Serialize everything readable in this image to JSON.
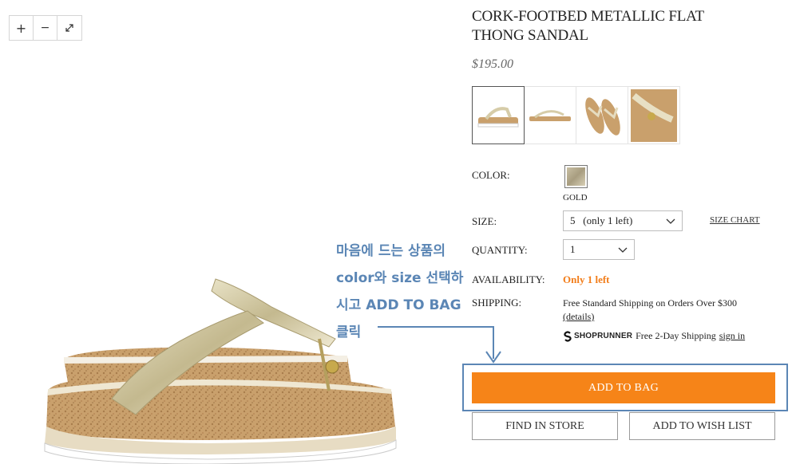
{
  "zoom_controls": {
    "zoom_in": "+",
    "zoom_out": "−"
  },
  "product": {
    "title": "CORK-FOOTBED METALLIC FLAT THONG SANDAL",
    "price": "$195.00"
  },
  "options": {
    "color_label": "COLOR:",
    "color_name": "GOLD",
    "size_label": "SIZE:",
    "size_value": "5   (only 1 left)",
    "size_chart": "SIZE CHART",
    "quantity_label": "QUANTITY:",
    "quantity_value": "1",
    "availability_label": "AVAILABILITY:",
    "availability_value": "Only 1 left",
    "shipping_label": "SHIPPING:",
    "shipping_text": "Free Standard Shipping on Orders Over $300",
    "shipping_details": "(details)",
    "shoprunner_brand": "SHOPRUNNER",
    "shoprunner_text": "Free 2-Day Shipping",
    "shoprunner_signin": "sign in"
  },
  "buttons": {
    "add_to_bag": "ADD TO BAG",
    "find_in_store": "FIND IN STORE",
    "add_to_wish_list": "ADD TO WISH LIST"
  },
  "annotation": {
    "line1": "마음에 드는 상품의",
    "line2": "color와 size 선택하",
    "line3": "시고 ADD TO BAG",
    "line4": "클릭"
  },
  "colors": {
    "accent_orange": "#f68418",
    "availability_orange": "#f27d1a",
    "annotation_blue": "#5b86b5"
  },
  "icons": {
    "zoom_in": "plus-icon",
    "zoom_out": "minus-icon",
    "fullscreen": "expand-icon",
    "dropdown": "chevron-down-icon",
    "shoprunner": "shoprunner-logo-icon"
  }
}
